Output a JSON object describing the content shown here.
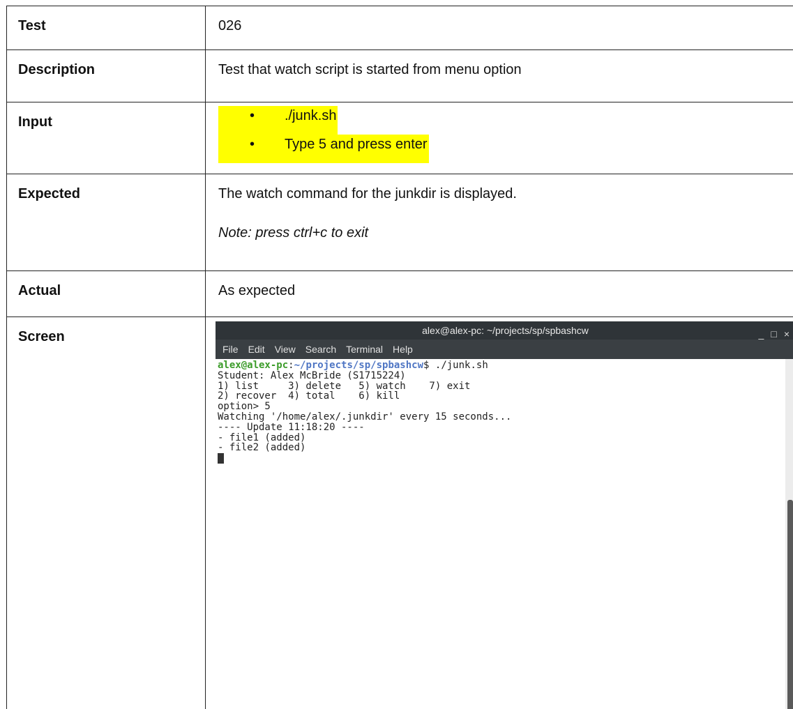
{
  "rows": {
    "test": {
      "label": "Test",
      "value": "026"
    },
    "description": {
      "label": "Description",
      "value": "Test that watch script is started from menu option"
    },
    "input": {
      "label": "Input",
      "items": [
        "./junk.sh",
        "Type 5 and press enter"
      ]
    },
    "expected": {
      "label": "Expected",
      "value": "The watch command for the junkdir is displayed.",
      "note": "Note: press ctrl+c to exit"
    },
    "actual": {
      "label": "Actual",
      "value": "As expected"
    },
    "screen": {
      "label": "Screen"
    }
  },
  "terminal": {
    "title": "alex@alex-pc: ~/projects/sp/spbashcw",
    "controls": [
      "_",
      "□",
      "×"
    ],
    "menu": [
      "File",
      "Edit",
      "View",
      "Search",
      "Terminal",
      "Help"
    ],
    "prompt_user": "alex@alex-pc",
    "prompt_sep": ":",
    "prompt_path": "~/projects/sp/spbashcw",
    "prompt_cmd": "$ ./junk.sh",
    "lines": [
      "Student: Alex McBride (S1715224)",
      "1) list     3) delete   5) watch    7) exit",
      "2) recover  4) total    6) kill",
      "option> 5",
      "Watching '/home/alex/.junkdir' every 15 seconds...",
      "---- Update 11:18:20 ----",
      "- file1 (added)",
      "- file2 (added)"
    ]
  }
}
